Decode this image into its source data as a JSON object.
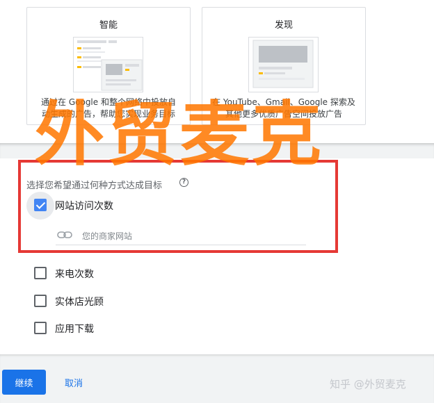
{
  "cards": [
    {
      "title": "智能",
      "desc_line1": "通过在 Google 和整个网络中投放自",
      "desc_line2": "动生成的广告，帮助您实现业务目标"
    },
    {
      "title": "发现",
      "desc_line1": "在 YouTube、Gmail、Google 探索及",
      "desc_line2": "其他更多优质广告空间投放广告"
    }
  ],
  "goal_section": {
    "question": "选择您希望通过何种方式达成目标",
    "help_icon": "help-circle-icon",
    "options": [
      {
        "label": "网站访问次数",
        "checked": true
      },
      {
        "label": "来电次数",
        "checked": false
      },
      {
        "label": "实体店光顾",
        "checked": false
      },
      {
        "label": "应用下载",
        "checked": false
      }
    ],
    "url_input": {
      "placeholder": "您的商家网站",
      "icon": "link-icon"
    }
  },
  "footer": {
    "continue_label": "继续",
    "cancel_label": "取消"
  },
  "watermark": {
    "big": "外贸麦克",
    "small": "知乎 @外贸麦克"
  },
  "colors": {
    "primary": "#1a73e8",
    "checkbox": "#4285f4",
    "highlight": "#e53935",
    "watermark": "#ff7700",
    "yellow_accent": "#fbbc04"
  }
}
